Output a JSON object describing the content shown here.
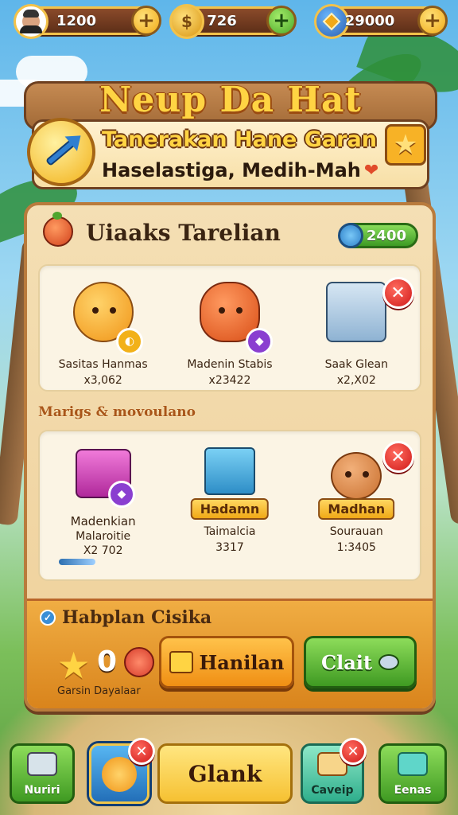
{
  "topbar": {
    "resources": [
      {
        "value": "1200",
        "icon": "avatar-icon"
      },
      {
        "value": "726",
        "icon": "coin-icon"
      },
      {
        "value": "29000",
        "icon": "gem-shield-icon"
      }
    ],
    "coin_symbol": "$"
  },
  "title_board": {
    "title": "Neup Da Hat",
    "subtitle": "Tanerakan Hane Garan",
    "tagline": "Haselastiga, Medih-Mah"
  },
  "panel": {
    "title": "Uiaaks Tarelian",
    "balance": "2400",
    "row1": [
      {
        "name": "Sasitas Hanmas",
        "qty": "x3,062"
      },
      {
        "name": "Madenin Stabis",
        "qty": "x23422"
      },
      {
        "name": "Saak Glean",
        "qty": "x2,X02"
      }
    ],
    "section_label": "Marigs & movoulano",
    "row2": [
      {
        "name": "Madenkian",
        "sub": "Malaroitie",
        "qty": "X2 702"
      },
      {
        "tag": "Hadamn",
        "sub": "Taimalcia",
        "qty": "3317"
      },
      {
        "tag": "Madhan",
        "sub": "Sourauan",
        "qty": "1:3405"
      }
    ]
  },
  "footer": {
    "title": "Habplan Cisika",
    "star_count": "0",
    "caption": "Garsin Dayalaar",
    "btn_primary": "Hanilan",
    "btn_secondary": "Clait"
  },
  "nav": {
    "items": [
      {
        "label": "Nuriri",
        "color": "#3f9a22"
      },
      {
        "label": "",
        "color": "#236fb8"
      },
      {
        "label": "Glank",
        "color": "#f6c132"
      },
      {
        "label": "Caveip",
        "color": "#2fae8c"
      },
      {
        "label": "Eenas",
        "color": "#3f9a22"
      }
    ]
  },
  "colors": {
    "accent": "#f0a917",
    "wood": "#a26a37",
    "panel": "#f4dfb4",
    "danger": "#d01a1a"
  }
}
